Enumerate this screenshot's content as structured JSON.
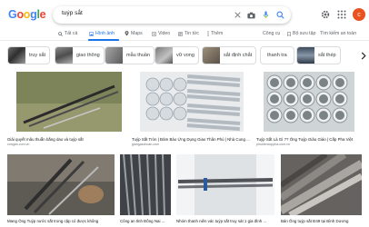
{
  "search": {
    "query": "tuýp sắt"
  },
  "avatar_letter": "c",
  "tabs": [
    {
      "label": "Tất cả",
      "icon": "search-icon"
    },
    {
      "label": "Hình ảnh",
      "icon": "image-icon",
      "active": true
    },
    {
      "label": "Maps",
      "icon": "map-pin-icon"
    },
    {
      "label": "Video",
      "icon": "video-icon"
    },
    {
      "label": "Tin tức",
      "icon": "news-icon"
    },
    {
      "label": "Thêm",
      "icon": "more-icon"
    }
  ],
  "tools": {
    "tools_label": "Công cụ",
    "safe_label": "Bộ sưu tập",
    "safesearch_label": "Tìm kiếm an toàn"
  },
  "chips": [
    "truy sắt",
    "giao thông",
    "mẫu thuần",
    "vữ vong",
    "sắt định chắt",
    "thanh tra",
    "sắt thép"
  ],
  "results": [
    {
      "title": "Giải quyết mâu thuẫn bằng dao và tuýp sắt",
      "source": "congan.com.vn"
    },
    {
      "title": "Tuýp Sắt Tròn | Đảm Bảo Ứng Dụng Giao Thân Phú | Nhà Cung ...",
      "source": "giangaschuan.com"
    },
    {
      "title": "Tuýp Sắt Là Gì ?? Ống Tuýp Giảo Giáo | Cấp Pha Việt",
      "source": "phukiencoppha.com.vn"
    },
    {
      "title": "Mang Ống Tuýp nước sắt trong cặp có được không",
      "source": "phapluat.vn"
    },
    {
      "title": "Công an tỉnh Đồng Nai ...",
      "source": "baoquangnam.vn"
    },
    {
      "title": "Nhóm thanh niên vác tuýp sắt truy sát 1 gia đình ...",
      "source": "dantri.com.vn"
    },
    {
      "title": "Bán Ống tuýp sắt Đ49 tại Bình Dương",
      "source": "ongthepbinhduong.com"
    }
  ]
}
